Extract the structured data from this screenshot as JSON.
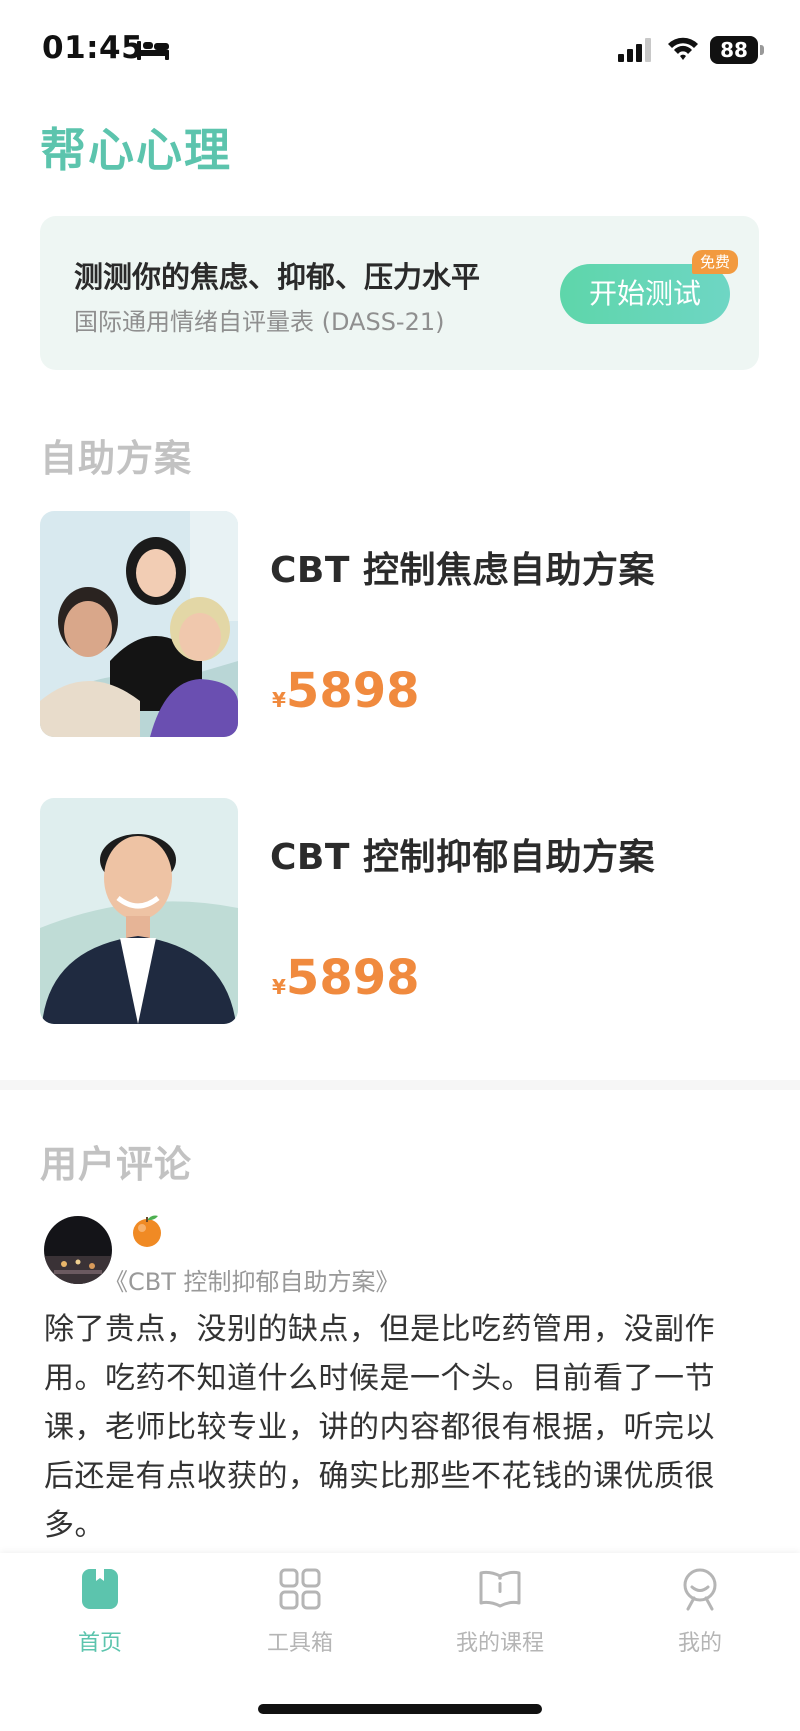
{
  "status_bar": {
    "time": "01:45",
    "battery": "88",
    "icons": [
      "bed-icon",
      "signal-icon",
      "wifi-icon",
      "battery-icon"
    ]
  },
  "app": {
    "title": "帮心心理"
  },
  "test_banner": {
    "title": "测测你的焦虑、抑郁、压力水平",
    "subtitle": "国际通用情绪自评量表 (DASS-21)",
    "button": "开始测试",
    "badge": "免费"
  },
  "plans": {
    "heading": "自助方案",
    "items": [
      {
        "title": "CBT 控制焦虑自助方案",
        "currency": "¥",
        "price": "5898"
      },
      {
        "title": "CBT 控制抑郁自助方案",
        "currency": "¥",
        "price": "5898"
      }
    ]
  },
  "reviews": {
    "heading": "用户评论",
    "items": [
      {
        "emoji": "🍊",
        "course": "《CBT 控制抑郁自助方案》",
        "text": "除了贵点，没别的缺点，但是比吃药管用，没副作用。吃药不知道什么时候是一个头。目前看了一节课，老师比较专业，讲的内容都很有根据，听完以后还是有点收获的，确实比那些不花钱的课优质很多。"
      }
    ]
  },
  "tabs": [
    {
      "label": "首页",
      "icon": "home-book-icon",
      "active": true
    },
    {
      "label": "工具箱",
      "icon": "grid-icon",
      "active": false
    },
    {
      "label": "我的课程",
      "icon": "open-book-icon",
      "active": false
    },
    {
      "label": "我的",
      "icon": "profile-icon",
      "active": false
    }
  ],
  "colors": {
    "accent": "#5cc4ad",
    "price": "#f08a3e",
    "banner_bg": "#eef6f3",
    "badge": "#f29a3f"
  }
}
